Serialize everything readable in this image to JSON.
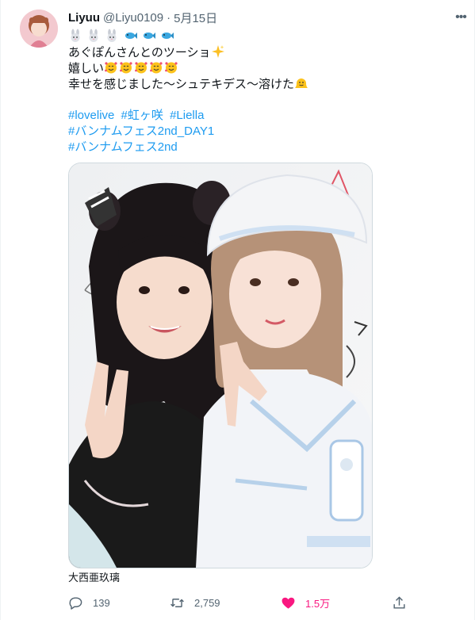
{
  "tweet": {
    "display_name": "Liyuu",
    "handle": "@Liyu0109",
    "separator": "·",
    "date": "5月15日",
    "more_label": "•••",
    "lines": {
      "line2": "あぐぽんさんとのツーショ",
      "line3": "嬉しい",
      "line4": "幸せを感じました〜シュテキデス〜溶けた"
    },
    "emoji": {
      "rabbit": "rabbit-emoji",
      "fish": "fish-emoji",
      "sparkles": "sparkles-emoji",
      "smiling_hearts": "smiling-face-with-hearts-emoji",
      "melting": "melting-face-emoji"
    },
    "hashtags": {
      "lovelive": "#lovelive",
      "nijigasaki": "#虹ヶ咲",
      "liella": "#Liella",
      "bandai_day1": "#バンナムフェス2nd_DAY1",
      "bandai": "#バンナムフェス2nd"
    },
    "photo_tag": "大西亜玖璃",
    "actions": {
      "replies": "139",
      "retweets": "2,759",
      "likes": "1.5万"
    },
    "colors": {
      "hashtag": "#1d9bf0",
      "secondary_text": "#536471",
      "like_active": "#f91880",
      "border": "#eff3f4"
    }
  }
}
